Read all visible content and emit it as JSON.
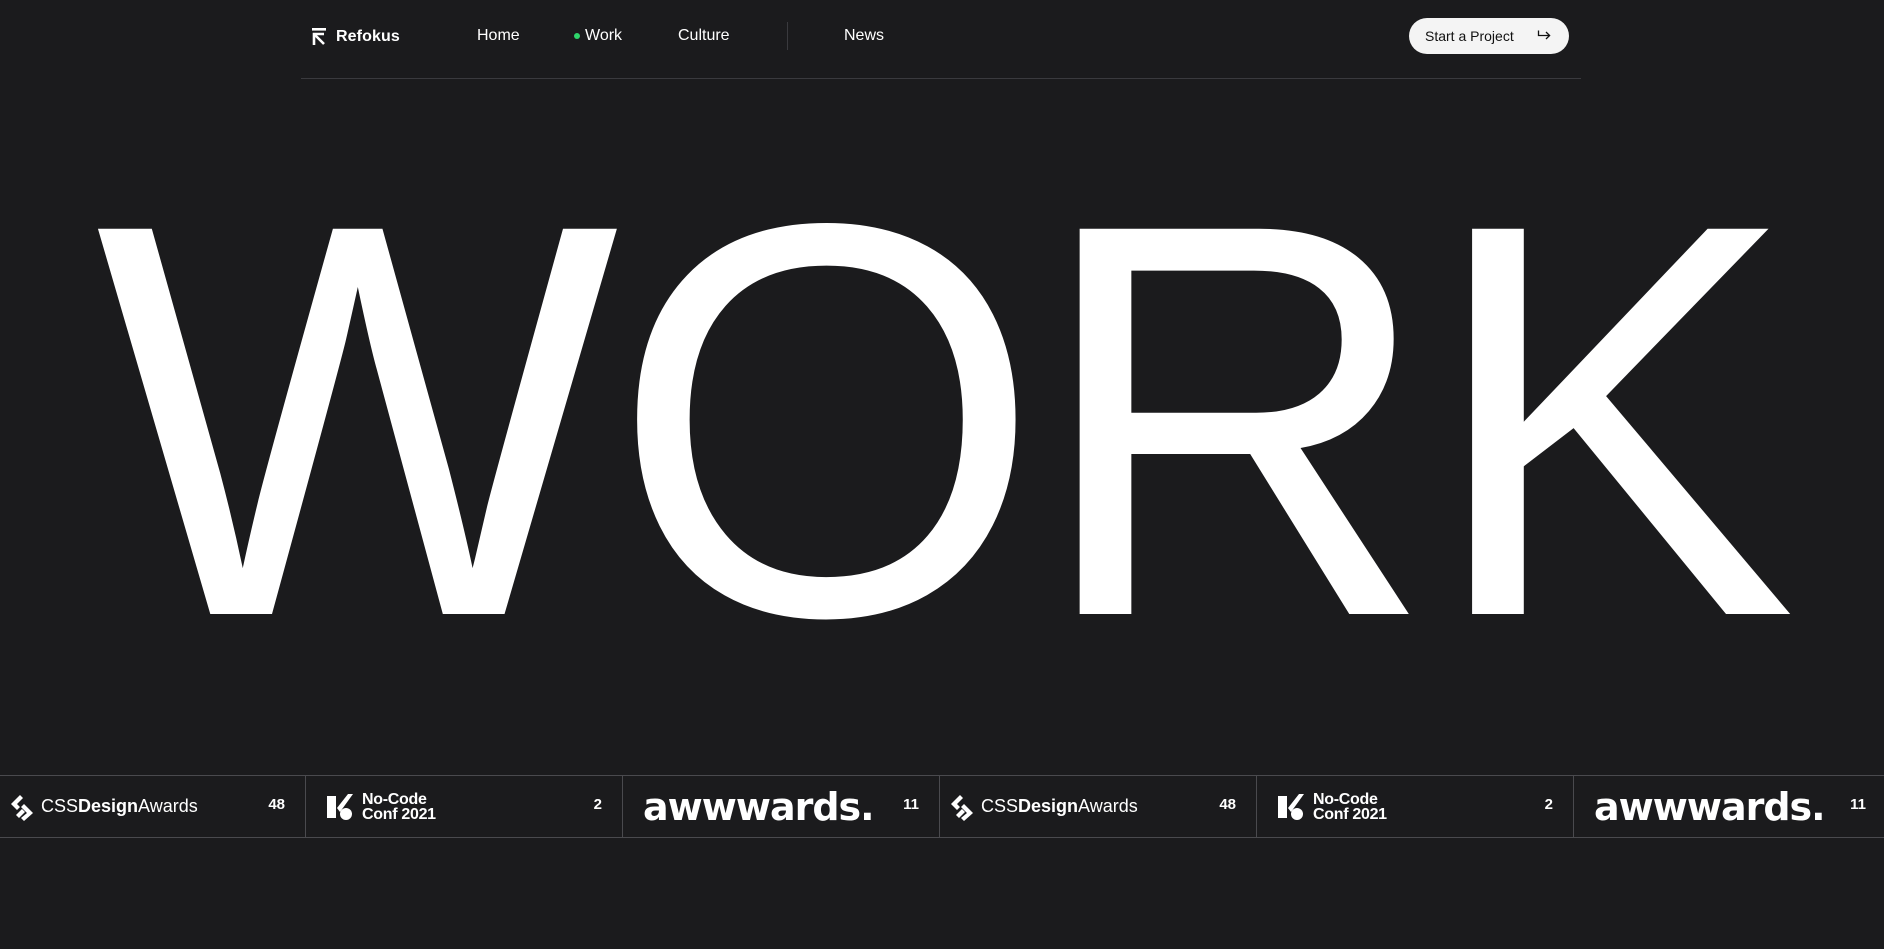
{
  "nav": {
    "brand": "Refokus",
    "links": {
      "home": "Home",
      "work": "Work",
      "culture": "Culture",
      "news": "News"
    },
    "active_link": "Work",
    "cta_label": "Start a Project"
  },
  "hero": {
    "title": "WORK"
  },
  "awards": [
    {
      "logo": "CSSDesignAwards",
      "logo_parts": [
        "CSS",
        "Design",
        "Awards"
      ],
      "count": "48"
    },
    {
      "logo": "No-Code Conf 2021",
      "logo_parts": [
        "No-Code",
        "Conf 2021"
      ],
      "count": "2"
    },
    {
      "logo": "awwwards.",
      "count": "11"
    },
    {
      "logo": "CSSDesignAwards",
      "logo_parts": [
        "CSS",
        "Design",
        "Awards"
      ],
      "count": "48"
    },
    {
      "logo": "No-Code Conf 2021",
      "logo_parts": [
        "No-Code",
        "Conf 2021"
      ],
      "count": "2"
    },
    {
      "logo": "awwwards.",
      "count": "11"
    }
  ],
  "colors": {
    "background": "#1b1b1d",
    "text": "#ffffff",
    "active_dot": "#2fd66b",
    "cta_background": "#f4f4f4"
  },
  "icons": {
    "brand": "refokus-logo-icon",
    "cta": "return-arrow-icon",
    "css_awards": "css-design-awards-icon",
    "nocode": "no-code-conf-icon"
  }
}
